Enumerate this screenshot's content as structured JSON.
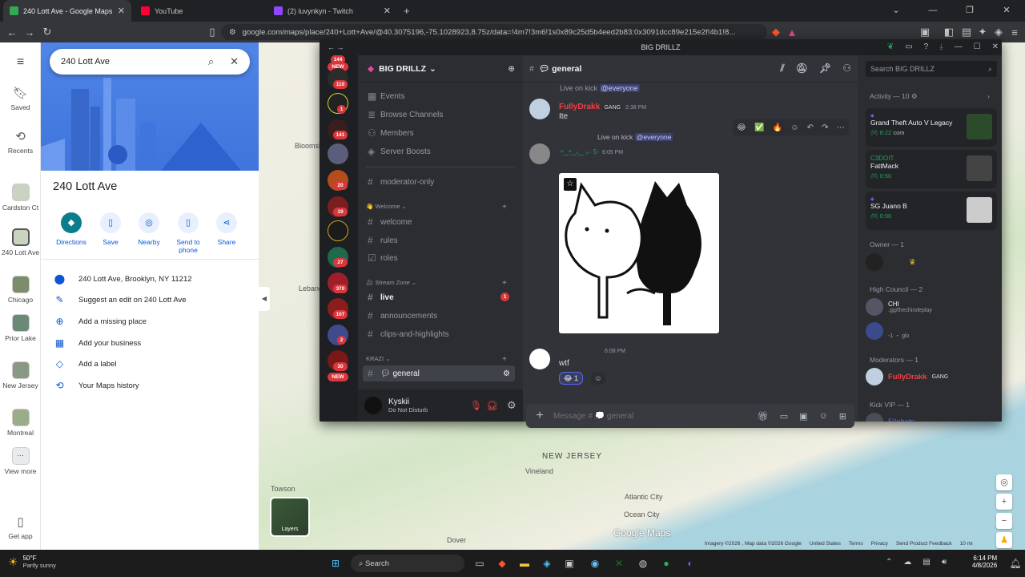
{
  "browser": {
    "tabs": [
      {
        "title": "240 Lott Ave - Google Maps",
        "active": true
      },
      {
        "title": "YouTube",
        "active": false
      },
      {
        "title": "(2) luvynkyn - Twitch",
        "active": false
      }
    ],
    "url": "google.com/maps/place/240+Lott+Ave/@40.3075196,-75.1028923,8.75z/data=!4m7!3m6!1s0x89c25d5b4eed2b83:0x3091dcc89e215e2f!4b1!8..."
  },
  "maps": {
    "search_value": "240 Lott Ave",
    "nav": [
      {
        "label": "Saved"
      },
      {
        "label": "Recents"
      },
      {
        "label": "Cardston Ct"
      },
      {
        "label": "240 Lott Ave"
      },
      {
        "label": "Chicago"
      },
      {
        "label": "Prior Lake"
      },
      {
        "label": "New Jersey"
      },
      {
        "label": "Montreal"
      },
      {
        "label": "View more"
      },
      {
        "label": "Get app"
      }
    ],
    "place_title": "240 Lott Ave",
    "actions": [
      "Directions",
      "Save",
      "Nearby",
      "Send to phone",
      "Share"
    ],
    "details": [
      "240 Lott Ave, Brooklyn, NY 11212",
      "Suggest an edit on 240 Lott Ave",
      "Add a missing place",
      "Add your business",
      "Add a label",
      "Your Maps history"
    ],
    "map_labels": {
      "bloomsburg": "Bloomsb",
      "lebanon": "Lebano",
      "new_jersey": "NEW JERSEY",
      "vineland": "Vineland",
      "atlantic_city": "Atlantic City",
      "ocean_city": "Ocean City",
      "towson": "Towson",
      "dover": "Dover"
    },
    "layers_label": "Layers",
    "logo": "Google Maps",
    "footer": [
      "Imagery ©2026 , Map data ©2026 Google",
      "United States",
      "Terms",
      "Privacy",
      "Send Product Feedback",
      "10 mi"
    ]
  },
  "discord": {
    "window_title": "BIG DRILLZ",
    "server_name": "BIG DRILLZ",
    "server_badges": [
      "NEW",
      "110",
      "1",
      "141",
      "20",
      "19",
      "27",
      "370",
      "107",
      "2",
      "30",
      "NEW"
    ],
    "top_badge": "144",
    "menu_items": [
      "Events",
      "Browse Channels",
      "Members",
      "Server Boosts"
    ],
    "channels": {
      "top": "moderator-only",
      "welcome_cat": "Welcome",
      "welcome": [
        "welcome",
        "rules",
        "roles"
      ],
      "stream_cat": "Stream Zone",
      "stream": [
        "live",
        "announcements",
        "clips-and-highlights"
      ],
      "live_badge": "1",
      "krazi_cat": "KRAZI",
      "selected": "general"
    },
    "user": {
      "name": "Kyskii",
      "status": "Do Not Disturb"
    },
    "chat": {
      "channel": "general",
      "messages": [
        {
          "author": "FullyDrakk",
          "tag": "GANG",
          "time": "2:38 PM",
          "text": "Ite"
        },
        {
          "reply": "Live on kick",
          "mention": "@everyone",
          "author": "-ᵒ‿ᵒ‿ₛ‿ ₅₋ 5-",
          "time": "6:05 PM"
        },
        {
          "time": "6:08 PM",
          "text": "wtf",
          "reaction_count": "1"
        }
      ],
      "prev_text": "Live on kick",
      "prev_mention": "@everyone",
      "composer_placeholder": "Message # 💭 general"
    },
    "members": {
      "search_placeholder": "Search BIG DRILLZ",
      "activity_title": "Activity — 10",
      "cards": [
        {
          "title": "Grand Theft Auto V Legacy",
          "time": "6:22",
          "extra": "com"
        },
        {
          "user": "C3DOIT",
          "title": "FattMack",
          "time": "0:50"
        },
        {
          "title": "SG Juano B",
          "time": "0:00"
        }
      ],
      "owner_title": "Owner — 1",
      "high_council_title": "High Council — 2",
      "hc1": "CHI",
      "hc1_sub": ".gg/thechiroleplay",
      "hc2_sub": "-1 ・ glo",
      "moderators_title": "Moderators — 1",
      "moderator": "FullyDrakk",
      "moderator_tag": "GANG",
      "kickvip_title": "Kick VIP — 1",
      "kickvip": "50shots"
    }
  },
  "taskbar": {
    "weather_temp": "50°F",
    "weather_desc": "Partly sunny",
    "search": "Search",
    "time": "6:14 PM",
    "date": "4/8/2026"
  }
}
